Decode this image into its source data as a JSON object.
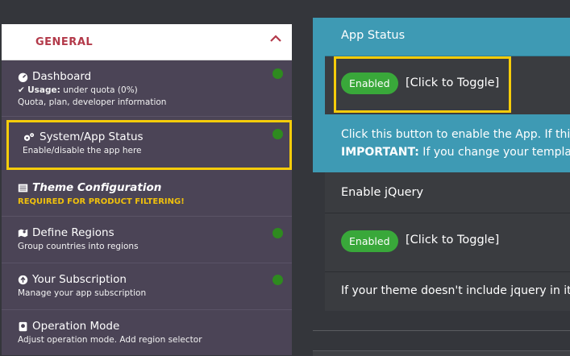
{
  "sidebar": {
    "header": "GENERAL",
    "items": [
      {
        "label": "Dashboard",
        "usage_prefix": "Usage:",
        "usage_value": "under quota (0%)",
        "sub": "Quota, plan, developer information"
      },
      {
        "label": "System/App Status",
        "sub": "Enable/disable the app here"
      },
      {
        "label": "Theme Configuration",
        "warning": "REQUIRED FOR PRODUCT FILTERING!"
      },
      {
        "label": "Define Regions",
        "sub": "Group countries into regions"
      },
      {
        "label": "Your Subscription",
        "sub": "Manage your app subscription"
      },
      {
        "label": "Operation Mode",
        "sub": "Adjust operation mode. Add region selector"
      }
    ]
  },
  "main": {
    "app_status": {
      "title": "App Status",
      "badge": "Enabled",
      "toggle": "[Click to Toggle]",
      "desc_line1": "Click this button to enable the App. If thi",
      "desc_important": "IMPORTANT:",
      "desc_line2": " If you change your templa"
    },
    "jquery": {
      "title": "Enable jQuery",
      "badge": "Enabled",
      "toggle": "[Click to Toggle]",
      "desc": "If your theme doesn't include jquery in it"
    }
  },
  "colors": {
    "sidebar_bg": "#4b4456",
    "accent_header": "#b33a4a",
    "status_dot": "#2e8a1f",
    "highlight": "#f5cc0a",
    "badge_green": "#39a83a",
    "panel_blue": "#3e9ab4"
  }
}
